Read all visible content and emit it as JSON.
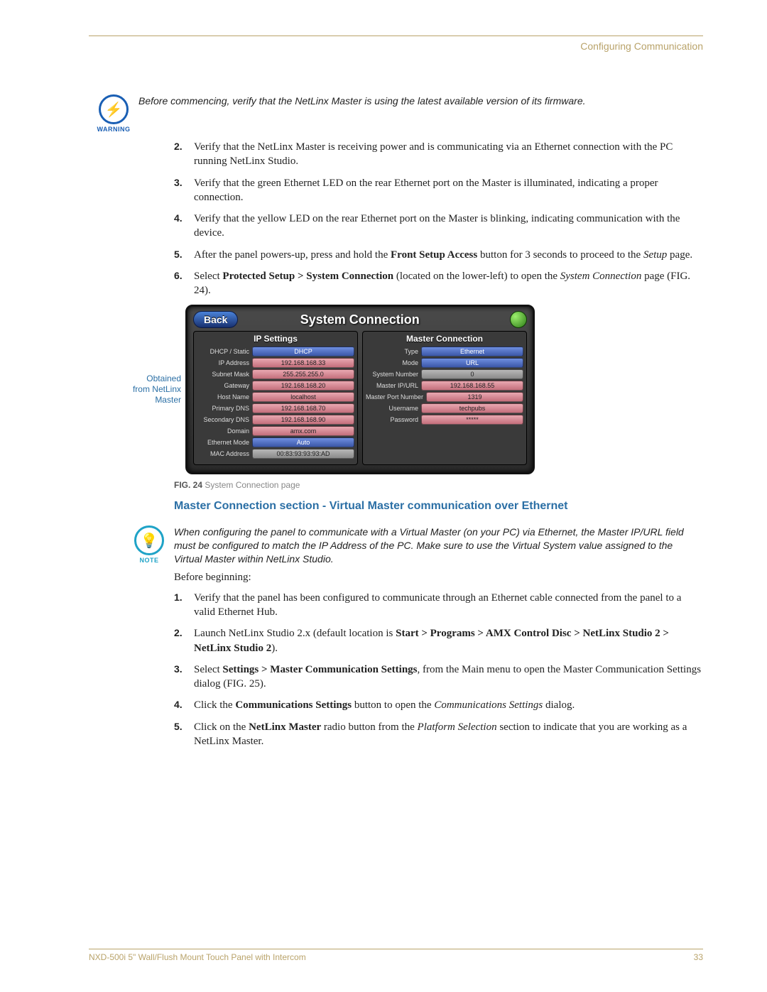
{
  "header": {
    "section": "Configuring Communication"
  },
  "warning": {
    "label": "WARNING",
    "text": "Before commencing, verify that the NetLinx Master is using the latest available version of its firmware."
  },
  "stepsA": [
    {
      "n": "2.",
      "html": "Verify that the NetLinx Master is receiving power and is communicating via an Ethernet connection with the PC running NetLinx Studio."
    },
    {
      "n": "3.",
      "html": "Verify that the green Ethernet LED on the rear Ethernet port on the Master is illuminated, indicating a proper connection."
    },
    {
      "n": "4.",
      "html": "Verify that the yellow LED on the rear Ethernet port on the Master is blinking, indicating communication with the device."
    },
    {
      "n": "5.",
      "html": "After the panel powers-up, press and hold the <b>Front Setup Access</b> button for 3 seconds to proceed to the <i>Setup</i> page."
    },
    {
      "n": "6.",
      "html": "Select <b>Protected Setup &gt; System Connection</b> (located on the lower-left) to open the <i>System Connection</i> page (FIG. 24)."
    }
  ],
  "figure": {
    "callout": "Obtained from NetLinx Master",
    "back": "Back",
    "title": "System Connection",
    "left_header": "IP Settings",
    "right_header": "Master Connection",
    "left_rows": [
      {
        "label": "DHCP / Static",
        "value": "DHCP",
        "cls": "v-blue"
      },
      {
        "label": "IP Address",
        "value": "192.168.168.33",
        "cls": "v-pink"
      },
      {
        "label": "Subnet Mask",
        "value": "255.255.255.0",
        "cls": "v-pink"
      },
      {
        "label": "Gateway",
        "value": "192.168.168.20",
        "cls": "v-pink"
      },
      {
        "label": "Host Name",
        "value": "localhost",
        "cls": "v-pink"
      },
      {
        "label": "Primary DNS",
        "value": "192.168.168.70",
        "cls": "v-pink"
      },
      {
        "label": "Secondary DNS",
        "value": "192.168.168.90",
        "cls": "v-pink"
      },
      {
        "label": "Domain",
        "value": "amx.com",
        "cls": "v-pink"
      },
      {
        "label": "Ethernet Mode",
        "value": "Auto",
        "cls": "v-blue"
      },
      {
        "label": "MAC Address",
        "value": "00:83:93:93:93:AD",
        "cls": "v-gray"
      }
    ],
    "right_rows": [
      {
        "label": "Type",
        "value": "Ethernet",
        "cls": "v-blue"
      },
      {
        "label": "Mode",
        "value": "URL",
        "cls": "v-blue"
      },
      {
        "label": "System Number",
        "value": "0",
        "cls": "v-gray"
      },
      {
        "label": "Master IP/URL",
        "value": "192.168.168.55",
        "cls": "v-pink"
      },
      {
        "label": "Master Port Number",
        "value": "1319",
        "cls": "v-pink"
      },
      {
        "label": "Username",
        "value": "techpubs",
        "cls": "v-pink"
      },
      {
        "label": "Password",
        "value": "*****",
        "cls": "v-pink"
      }
    ],
    "caption_label": "FIG. 24",
    "caption_text": "System Connection page"
  },
  "subheading": "Master Connection section - Virtual Master communication over Ethernet",
  "note": {
    "label": "NOTE",
    "text": "When configuring the panel to communicate with a Virtual Master (on your PC) via Ethernet, the Master IP/URL field must be configured to match the IP Address of the PC. Make sure to use the Virtual System value assigned to the Virtual Master within NetLinx Studio."
  },
  "lead": "Before beginning:",
  "stepsB": [
    {
      "n": "1.",
      "html": "Verify that the panel has been configured to communicate through an Ethernet cable connected from the panel to a valid Ethernet Hub."
    },
    {
      "n": "2.",
      "html": "Launch NetLinx Studio 2.x (default location is <b>Start &gt; Programs &gt; AMX Control Disc &gt; NetLinx Studio 2 &gt; NetLinx Studio 2</b>)."
    },
    {
      "n": "3.",
      "html": "Select <b>Settings &gt; Master Communication Settings</b>, from the Main menu to open the Master Communication Settings dialog (FIG. 25)."
    },
    {
      "n": "4.",
      "html": "Click the <b>Communications Settings</b> button to open the <i>Communications Settings</i> dialog."
    },
    {
      "n": "5.",
      "html": "Click on the <b>NetLinx Master</b> radio button from the <i>Platform Selection</i> section to indicate that you are working as a NetLinx Master."
    }
  ],
  "footer": {
    "left": "NXD-500i 5\" Wall/Flush Mount Touch Panel with Intercom",
    "right": "33"
  }
}
